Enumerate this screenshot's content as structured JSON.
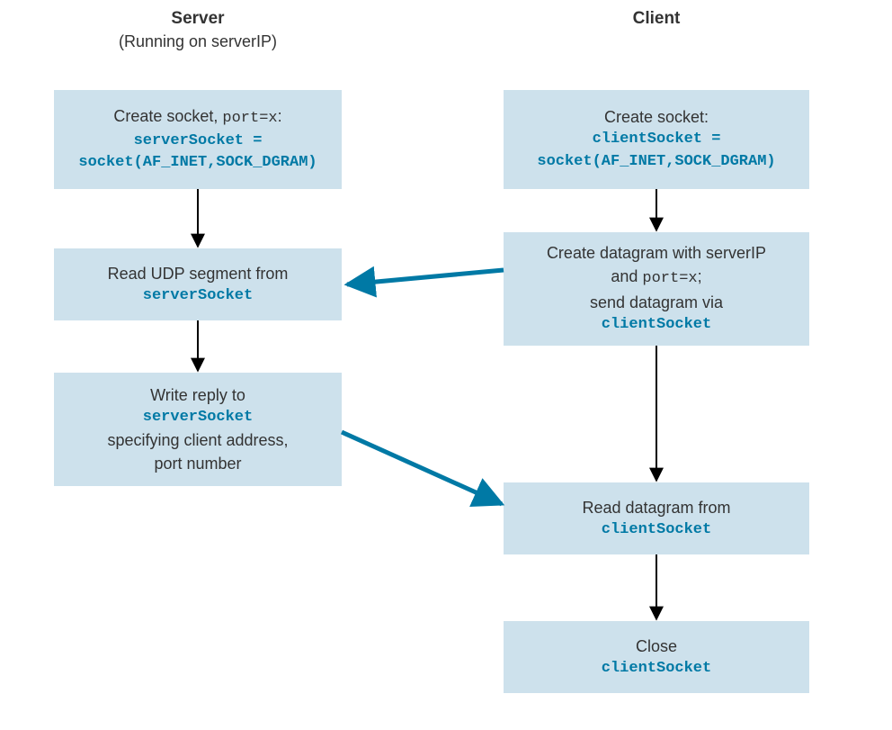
{
  "headers": {
    "server_title": "Server",
    "server_sub": "(Running on serverIP)",
    "client_title": "Client"
  },
  "server": {
    "box1_line1_pre": "Create  socket, ",
    "box1_line1_code": "port=x",
    "box1_line1_post": ":",
    "box1_line2": "serverSocket =",
    "box1_line3": "socket(AF_INET,SOCK_DGRAM)",
    "box2_line1": "Read UDP segment from",
    "box2_line2": "serverSocket",
    "box3_line1": "Write reply to",
    "box3_line2": "serverSocket",
    "box3_line3": "specifying client address,",
    "box3_line4": "port number"
  },
  "client": {
    "box1_line1": "Create socket:",
    "box1_line2": "clientSocket =",
    "box1_line3": "socket(AF_INET,SOCK_DGRAM)",
    "box2_line1": "Create datagram with serverIP",
    "box2_line2_pre": "and ",
    "box2_line2_code": "port=x",
    "box2_line2_post": ";",
    "box2_line3": "send datagram via",
    "box2_line4": "clientSocket",
    "box3_line1": "Read datagram from",
    "box3_line2": "clientSocket",
    "box4_line1": "Close",
    "box4_line2": "clientSocket"
  }
}
